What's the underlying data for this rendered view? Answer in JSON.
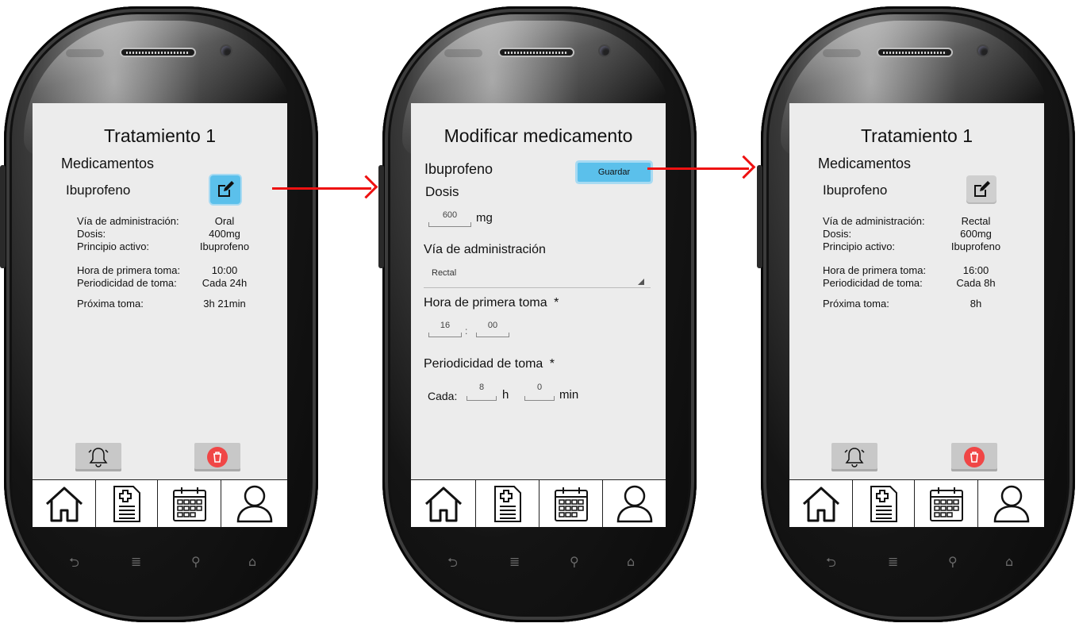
{
  "screens": [
    {
      "title": "Tratamiento 1",
      "section": "Medicamentos",
      "medicine": "Ibuprofeno",
      "details": [
        {
          "label": "Vía de administración:",
          "value": "Oral"
        },
        {
          "label": "Dosis:",
          "value": "400mg"
        },
        {
          "label": "Principio activo:",
          "value": "Ibuprofeno"
        },
        {
          "label": "Hora de primera toma:",
          "value": "10:00"
        },
        {
          "label": "Periodicidad de toma:",
          "value": "Cada 24h"
        },
        {
          "label": "Próxima toma:",
          "value": "3h 21min"
        }
      ]
    },
    {
      "title": "Modificar medicamento",
      "medicine": "Ibuprofeno",
      "save_label": "Guardar",
      "dose_label": "Dosis",
      "dose_value": "600",
      "dose_unit": "mg",
      "route_label": "Vía de administración",
      "route_value": "Rectal",
      "first_dose_label": "Hora de primera toma",
      "first_dose_hour": "16",
      "time_sep": ":",
      "first_dose_min": "00",
      "required_mark": "*",
      "period_label": "Periodicidad de toma",
      "every_label": "Cada:",
      "period_hours": "8",
      "hours_unit": "h",
      "period_minutes": "0",
      "minutes_unit": "min"
    },
    {
      "title": "Tratamiento 1",
      "section": "Medicamentos",
      "medicine": "Ibuprofeno",
      "details": [
        {
          "label": "Vía de administración:",
          "value": "Rectal"
        },
        {
          "label": "Dosis:",
          "value": "600mg"
        },
        {
          "label": "Principio activo:",
          "value": "Ibuprofeno"
        },
        {
          "label": "Hora de primera toma:",
          "value": "16:00"
        },
        {
          "label": "Periodicidad de toma:",
          "value": "Cada 8h"
        },
        {
          "label": "Próxima toma:",
          "value": "8h"
        }
      ]
    }
  ],
  "nav_icons": [
    "home-icon",
    "prescription-icon",
    "calendar-icon",
    "profile-icon"
  ],
  "hardware_icons": [
    "back-icon",
    "menu-icon",
    "search-icon",
    "home-key-icon"
  ],
  "colors": {
    "accent": "#5bc0eb",
    "arrow": "#ee1111",
    "delete": "#f04646",
    "screen_bg": "#ececec"
  }
}
